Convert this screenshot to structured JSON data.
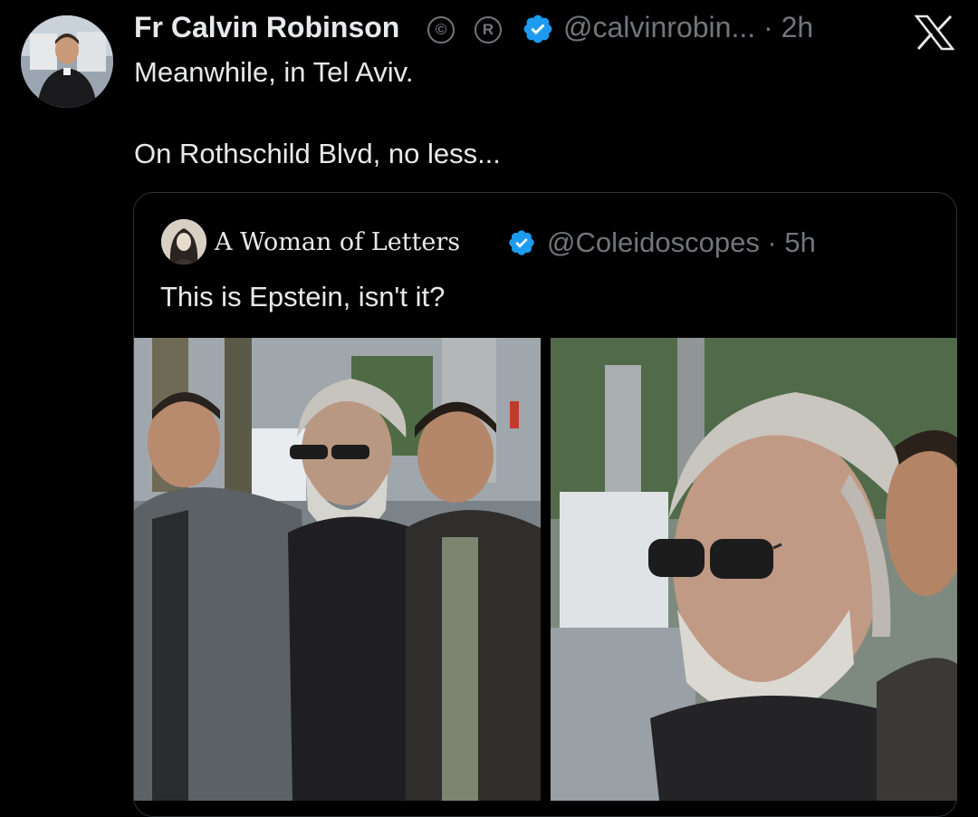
{
  "tweet": {
    "author_name": "Fr Calvin Robinson",
    "badge_c": "©",
    "badge_r": "R",
    "handle_time": "@calvinrobin... · 2h",
    "text_line1": "Meanwhile, in Tel Aviv.",
    "text_line2": "On Rothschild Blvd, no less..."
  },
  "quote": {
    "author_name": "A Woman of Letters",
    "handle_time": "@Coleidoscopes · 5h",
    "text": "This is Epstein, isn't it?"
  },
  "icons": {
    "verified": "verified-badge-icon",
    "x_logo": "x-logo-icon"
  },
  "colors": {
    "background": "#000000",
    "text_primary": "#e7e9ea",
    "text_secondary": "#71767b",
    "verified_blue": "#1d9bf0",
    "card_border": "#2f3336"
  }
}
